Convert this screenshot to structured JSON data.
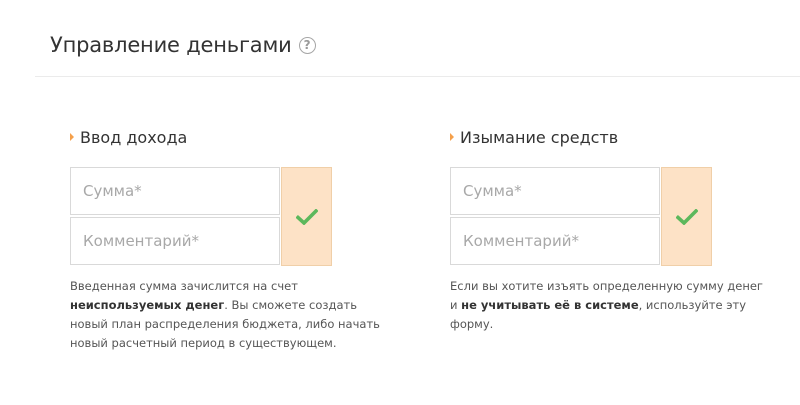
{
  "header": {
    "title": "Управление деньгами",
    "help_icon": "?"
  },
  "colors": {
    "accent": "#f5a04a",
    "submit_bg": "#fde2c6",
    "check": "#5cb85c"
  },
  "income": {
    "title": "Ввод дохода",
    "amount_placeholder": "Сумма*",
    "comment_placeholder": "Комментарий*",
    "submit_icon": "check-icon",
    "note": {
      "part1": "Введенная сумма зачислится на счет ",
      "bold1": "неиспользуемых денег",
      "part2": ". Вы сможете создать новый план распределения бюджета, либо начать новый расчетный период в существующем."
    }
  },
  "withdrawal": {
    "title": "Изымание средств",
    "amount_placeholder": "Сумма*",
    "comment_placeholder": "Комментарий*",
    "submit_icon": "check-icon",
    "note": {
      "part1": "Если вы хотите изъять определенную сумму денег и ",
      "bold1": "не учитывать её в системе",
      "part2": ", используйте эту форму."
    }
  }
}
